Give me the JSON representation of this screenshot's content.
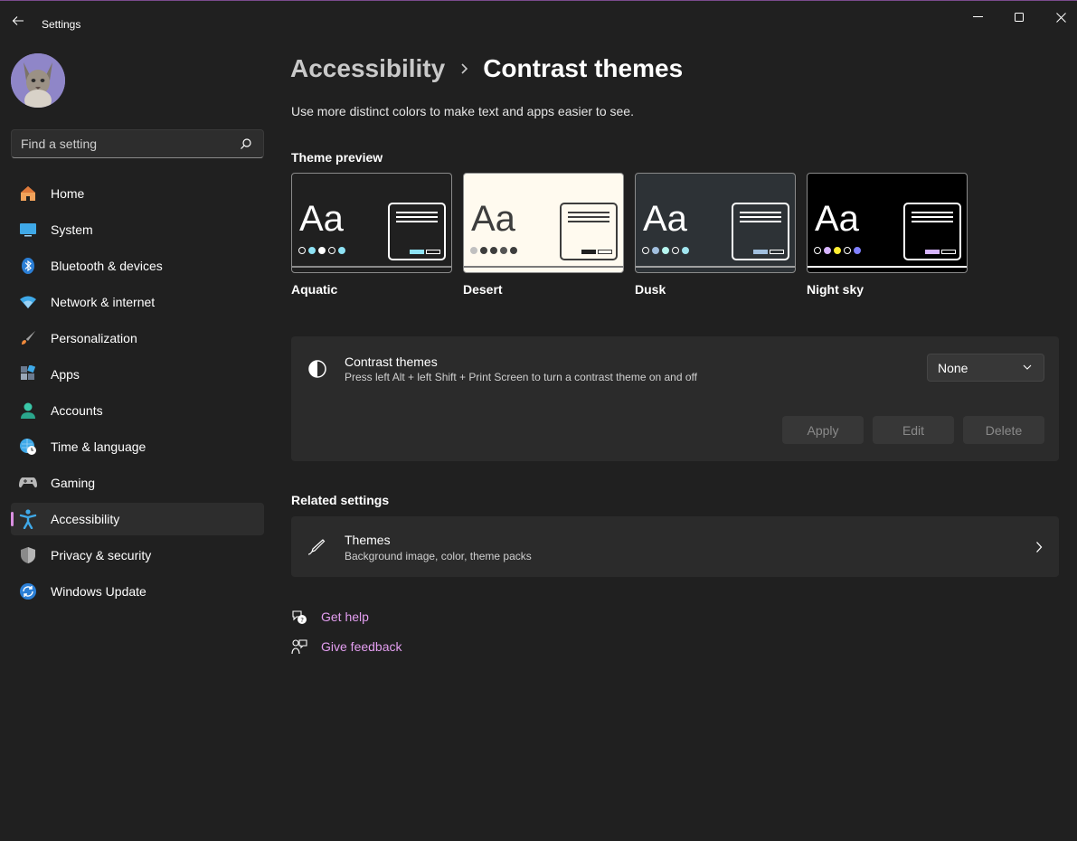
{
  "window": {
    "title": "Settings",
    "controls": [
      "minimize-icon",
      "maximize-icon",
      "close-icon"
    ]
  },
  "search": {
    "placeholder": "Find a setting"
  },
  "sidebar": {
    "items": [
      {
        "label": "Home",
        "icon": "home-icon"
      },
      {
        "label": "System",
        "icon": "system-icon"
      },
      {
        "label": "Bluetooth & devices",
        "icon": "bluetooth-icon"
      },
      {
        "label": "Network & internet",
        "icon": "wifi-icon"
      },
      {
        "label": "Personalization",
        "icon": "brush-icon"
      },
      {
        "label": "Apps",
        "icon": "apps-icon"
      },
      {
        "label": "Accounts",
        "icon": "accounts-icon"
      },
      {
        "label": "Time & language",
        "icon": "globe-clock-icon"
      },
      {
        "label": "Gaming",
        "icon": "gamepad-icon"
      },
      {
        "label": "Accessibility",
        "icon": "accessibility-icon",
        "selected": true
      },
      {
        "label": "Privacy & security",
        "icon": "shield-icon"
      },
      {
        "label": "Windows Update",
        "icon": "update-icon"
      }
    ]
  },
  "header": {
    "breadcrumb_parent": "Accessibility",
    "title": "Contrast themes",
    "description": "Use more distinct colors to make text and apps easier to see."
  },
  "preview": {
    "heading": "Theme preview",
    "sample_text": "Aa",
    "themes": [
      {
        "name": "Aquatic",
        "bg": "#202020",
        "fg": "#ffffff",
        "dots": [
          "#202020",
          "#8ee3f5",
          "#ffffff",
          "#202020",
          "#8ee3f5"
        ],
        "accent": "#8ee3f5",
        "bar": "#8a8a8a"
      },
      {
        "name": "Desert",
        "bg": "#fffaef",
        "fg": "#3d3d3d",
        "dots": [
          "#c0c0c0",
          "#3d3d3d",
          "#3d3d3d",
          "#555555",
          "#3d3d3d"
        ],
        "accent": "#202020",
        "bar": "#7a7a7a"
      },
      {
        "name": "Dusk",
        "bg": "#2d3236",
        "fg": "#ffffff",
        "dots": [
          "#2d3236",
          "#a1bfde",
          "#b6f6f0",
          "#2d3236",
          "#a1e6f0"
        ],
        "accent": "#a1bfde",
        "bar": "#a0a0a0"
      },
      {
        "name": "Night sky",
        "bg": "#000000",
        "fg": "#ffffff",
        "dots": [
          "#000000",
          "#d6b4fd",
          "#ffee32",
          "#000000",
          "#8080ff"
        ],
        "accent": "#d6b4fd",
        "bar": "#ffffff"
      }
    ]
  },
  "contrast_panel": {
    "title": "Contrast themes",
    "subtitle": "Press left Alt + left Shift + Print Screen to turn a contrast theme on and off",
    "dropdown_value": "None",
    "apply_label": "Apply",
    "edit_label": "Edit",
    "delete_label": "Delete"
  },
  "related": {
    "heading": "Related settings",
    "item_title": "Themes",
    "item_subtitle": "Background image, color, theme packs"
  },
  "help": {
    "get_help": "Get help",
    "give_feedback": "Give feedback"
  },
  "colors": {
    "background": "#202020",
    "card": "#2b2b2b",
    "accent": "#d98fe0",
    "link": "#e39ef0"
  }
}
